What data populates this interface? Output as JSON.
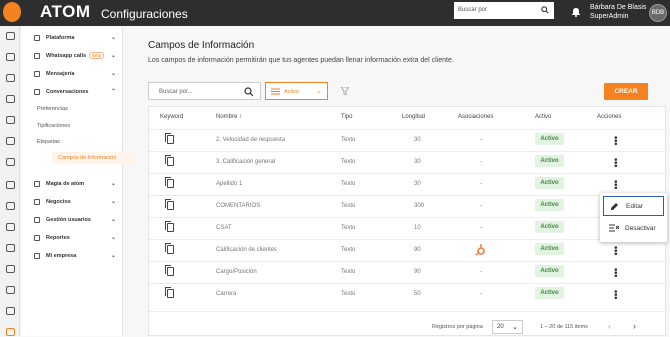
{
  "header": {
    "brand": "ATOM",
    "section": "Configuraciones",
    "search_placeholder": "Buscar por",
    "user_name": "Bárbara De Blasis",
    "user_role": "SuperAdmin",
    "avatar_initials": "BDB"
  },
  "menu": {
    "items": [
      {
        "label": "Plataforma",
        "chevron": "⌄"
      },
      {
        "label": "Whatsapp calls",
        "badge": "Beta",
        "chevron": "⌄"
      },
      {
        "label": "Mensajería",
        "chevron": "⌄"
      },
      {
        "label": "Conversaciones",
        "chevron": "⌃"
      }
    ],
    "subitems": [
      "Preferencias",
      "Tipificaciones",
      "Etiquetas",
      "Campos de Información"
    ],
    "items2": [
      {
        "label": "Magia de atom",
        "chevron": "⌄"
      },
      {
        "label": "Negocios",
        "chevron": "⌄"
      },
      {
        "label": "Gestión usuarios",
        "chevron": "⌄"
      },
      {
        "label": "Reportes",
        "chevron": "⌄"
      },
      {
        "label": "Mi empresa",
        "chevron": "⌄"
      }
    ]
  },
  "page": {
    "title": "Campos de Información",
    "description": "Los campos de información permitirán que tus agentes puedan llenar información extra del cliente.",
    "search_placeholder": "Buscar por...",
    "filter_value": "Activo",
    "create_label": "CREAR"
  },
  "table": {
    "headers": [
      "Keyword",
      "Nombre ↑",
      "Tipo",
      "Longitud",
      "Asociaciones",
      "Activo",
      "Acciones"
    ],
    "rows": [
      {
        "nombre": "2. Velocidad de respuesta",
        "tipo": "Texto",
        "longitud": "30",
        "asoc": "-",
        "activo": "Activo"
      },
      {
        "nombre": "3. Calificación general",
        "tipo": "Texto",
        "longitud": "30",
        "asoc": "-",
        "activo": "Activo"
      },
      {
        "nombre": "Apellido 1",
        "tipo": "Texto",
        "longitud": "30",
        "asoc": "-",
        "activo": "Activo"
      },
      {
        "nombre": "COMENTARIOS",
        "tipo": "Texto",
        "longitud": "300",
        "asoc": "-",
        "activo": "Activo"
      },
      {
        "nombre": "CSAT",
        "tipo": "Texto",
        "longitud": "10",
        "asoc": "-",
        "activo": "Activo"
      },
      {
        "nombre": "Calificación de clientes",
        "tipo": "Texto",
        "longitud": "90",
        "asoc": "hubspot-icon",
        "activo": "Activo"
      },
      {
        "nombre": "Cargo/Posición",
        "tipo": "Texto",
        "longitud": "90",
        "asoc": "-",
        "activo": "Activo"
      },
      {
        "nombre": "Carrera",
        "tipo": "Texto",
        "longitud": "50",
        "asoc": "-",
        "activo": "Activo"
      }
    ]
  },
  "pager": {
    "rows_label": "Registros por página",
    "rows_value": "20",
    "count": "1 – 20 de 115 items",
    "prev": "‹",
    "next": "›"
  },
  "popup": {
    "edit": "Editar",
    "deactivate": "Desactivar"
  },
  "colors": {
    "accent": "#f58220",
    "topbar": "#2e2e2e",
    "active_badge": "#e3f3e1"
  }
}
